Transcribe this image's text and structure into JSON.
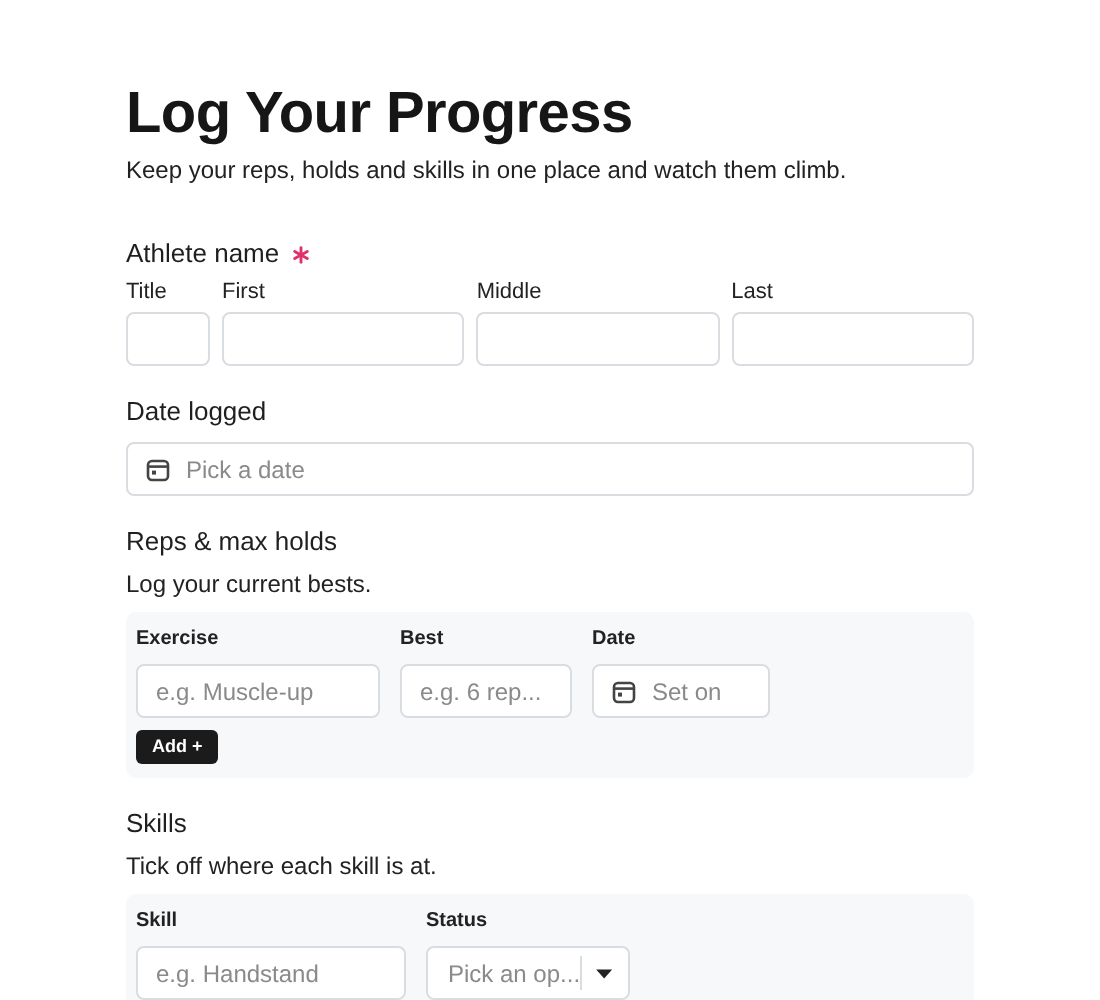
{
  "title": "Log Your Progress",
  "subtitle": "Keep your reps, holds and skills in one place and watch them climb.",
  "sections": [
    {
      "kind": "name",
      "label": "Athlete name",
      "required": true,
      "fields": [
        {
          "label": "Title"
        },
        {
          "label": "First"
        },
        {
          "label": "Middle"
        },
        {
          "label": "Last"
        }
      ]
    },
    {
      "kind": "date",
      "label": "Date logged",
      "required": false,
      "placeholder": "Pick a date"
    },
    {
      "kind": "table",
      "label": "Reps & max holds",
      "required": false,
      "description": "Log your current bests.",
      "columns": [
        {
          "label": "Exercise",
          "kind": "text",
          "placeholder": "e.g. Muscle-up"
        },
        {
          "label": "Best",
          "kind": "text",
          "placeholder": "e.g. 6 rep..."
        },
        {
          "label": "Date",
          "kind": "date",
          "placeholder": "Set on"
        }
      ],
      "add_button": "Add +"
    },
    {
      "kind": "table",
      "label": "Skills",
      "required": false,
      "description": "Tick off where each skill is at.",
      "columns": [
        {
          "label": "Skill",
          "kind": "text",
          "placeholder": "e.g. Handstand"
        },
        {
          "label": "Status",
          "kind": "select",
          "placeholder": "Pick an op..."
        }
      ]
    }
  ]
}
